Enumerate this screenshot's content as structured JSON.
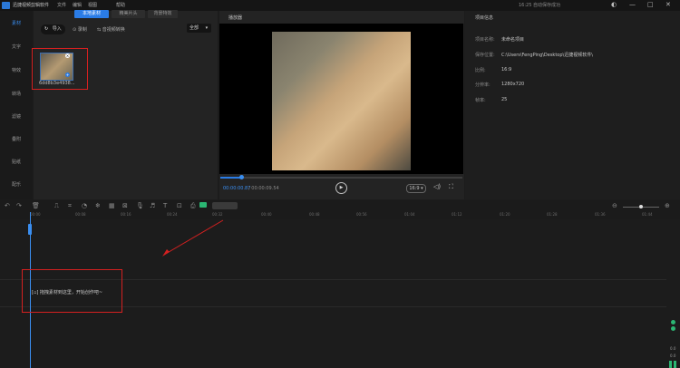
{
  "app": {
    "title": "迅捷视频剪辑软件"
  },
  "menu": [
    "文件",
    "编辑",
    "视图",
    "帮助"
  ],
  "save_status": "16:25 自动保存成功",
  "window_controls": [
    "skin-icon",
    "minimize-icon",
    "maximize-icon",
    "close-icon"
  ],
  "sidebar": {
    "items": [
      "素材",
      "文字",
      "特效",
      "转场",
      "滤镜",
      "叠附",
      "贴纸",
      "配乐"
    ],
    "active": 0
  },
  "library": {
    "tabs": [
      "本地素材",
      "精美片头",
      "背景特效"
    ],
    "active_tab": 0,
    "import_label": "导入",
    "record_label": "录制",
    "convert_label": "音视频转换",
    "filter_value": "全部",
    "media_name": "6dd8b3e4938..."
  },
  "player": {
    "header": "播放器",
    "time_current": "00:00:00.87",
    "time_total": "/ 00:00:09.54",
    "progress_fraction": 0.09,
    "ratio": "16:9"
  },
  "info": {
    "header": "项目信息",
    "rows": [
      {
        "label": "项目名称:",
        "value": "未命名项目"
      },
      {
        "label": "保存位置:",
        "value": "C:\\Users\\FengPing\\Desktop\\迅捷视频软件\\"
      },
      {
        "label": "比例:",
        "value": "16:9"
      },
      {
        "label": "分辨率:",
        "value": "1280x720"
      },
      {
        "label": "帧率:",
        "value": "25"
      }
    ]
  },
  "timeline": {
    "ruler": [
      "00:00",
      "00:08",
      "00:16",
      "00:24",
      "00:32",
      "00:40",
      "00:48",
      "00:56",
      "01:04",
      "01:12",
      "01:20",
      "01:28",
      "01:36",
      "01:44"
    ],
    "drag_hint": "拖拽素材到这里，开始创作吧~",
    "vu_labels": [
      "0.0",
      "0.0"
    ]
  },
  "colors": {
    "accent": "#2a7ce6",
    "highlight": "#d42020"
  }
}
